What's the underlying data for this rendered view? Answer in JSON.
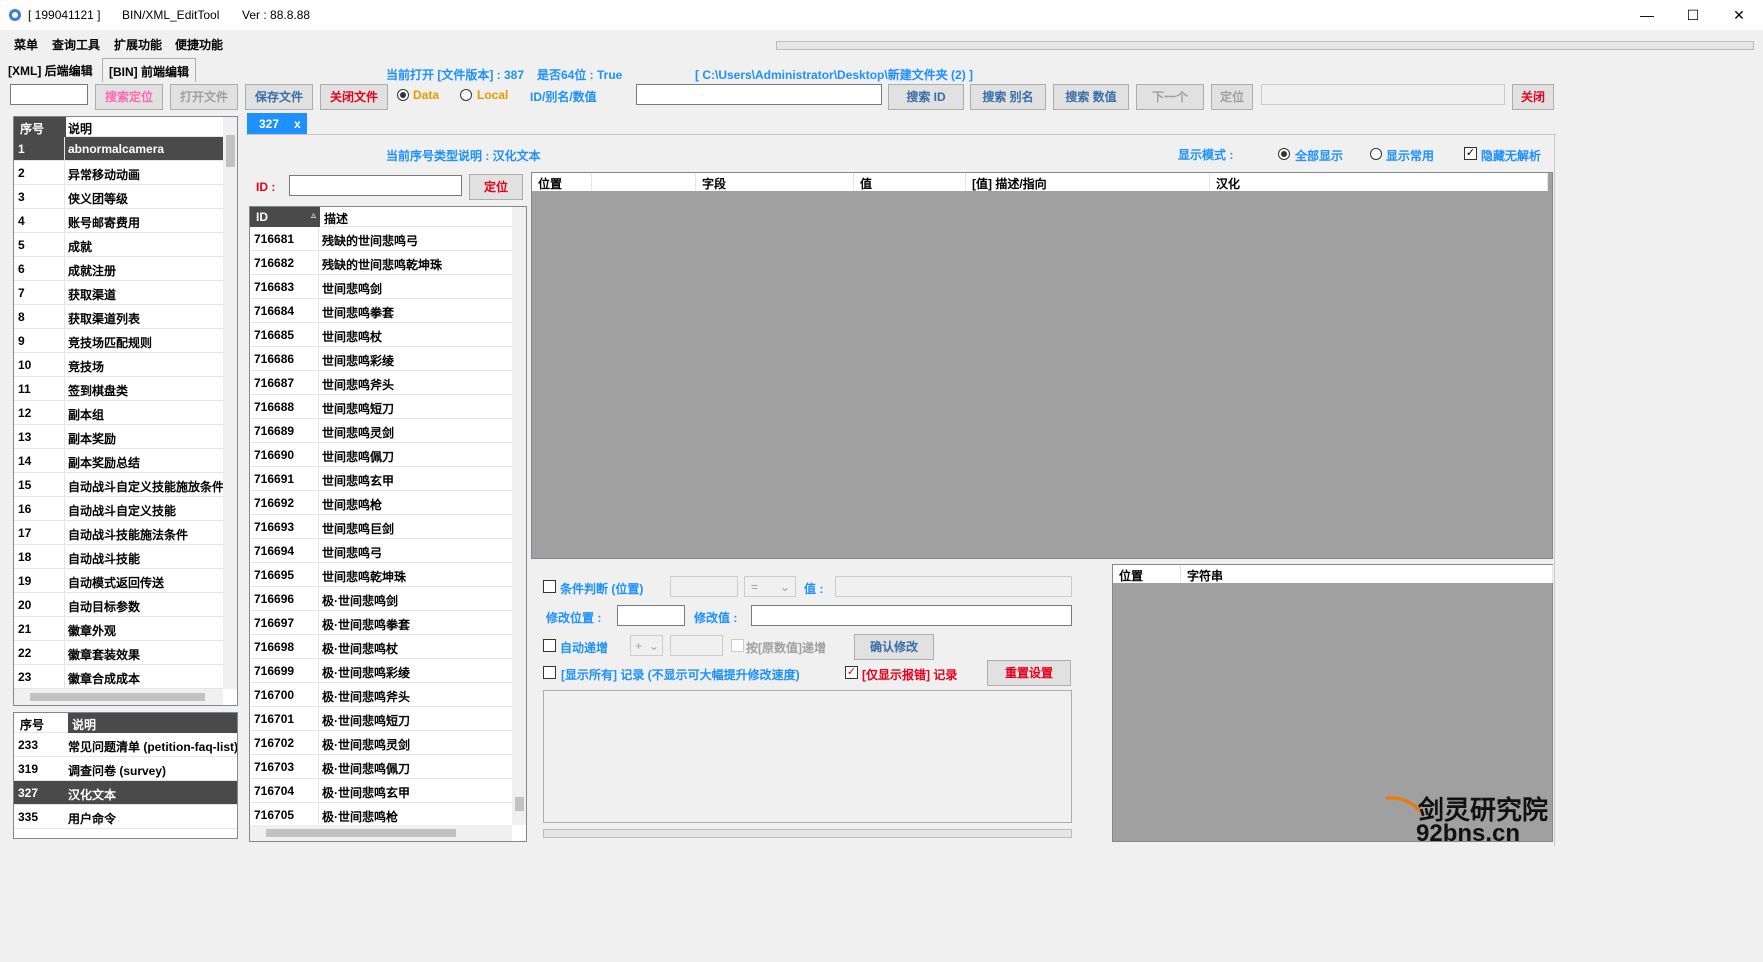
{
  "window": {
    "title_id": "[ 199041121 ]",
    "app_name": "BIN/XML_EditTool",
    "version": "Ver : 88.8.88",
    "minimize": "—",
    "maximize": "☐",
    "close": "✕"
  },
  "menu": [
    "菜单",
    "查询工具",
    "扩展功能",
    "便捷功能"
  ],
  "tabs": [
    "[XML] 后端编辑",
    "[BIN] 前端编辑"
  ],
  "info": {
    "current_open": "当前打开 [文件版本] : 387",
    "is64": "是否64位 : True",
    "path": "[ C:\\Users\\Administrator\\Desktop\\新建文件夹 (2) ]"
  },
  "toolbar": {
    "search_locate": "搜索定位",
    "open_file": "打开文件",
    "save_file": "保存文件",
    "close_file": "关闭文件",
    "radio_data": "Data",
    "radio_local": "Local",
    "search_label": "ID/别名/数值",
    "search_id": "搜索 ID",
    "search_alias": "搜索 别名",
    "search_value": "搜索 数值",
    "next": "下一个",
    "locate": "定位",
    "close": "关闭"
  },
  "left_list": {
    "headers": [
      "序号",
      "说明"
    ],
    "rows": [
      [
        "1",
        "abnormalcamera"
      ],
      [
        "2",
        "异常移动动画"
      ],
      [
        "3",
        "侠义团等级"
      ],
      [
        "4",
        "账号邮寄费用"
      ],
      [
        "5",
        "成就"
      ],
      [
        "6",
        "成就注册"
      ],
      [
        "7",
        "获取渠道"
      ],
      [
        "8",
        "获取渠道列表"
      ],
      [
        "9",
        "竞技场匹配规则"
      ],
      [
        "10",
        "竞技场"
      ],
      [
        "11",
        "签到棋盘类"
      ],
      [
        "12",
        "副本组"
      ],
      [
        "13",
        "副本奖励"
      ],
      [
        "14",
        "副本奖励总结"
      ],
      [
        "15",
        "自动战斗自定义技能施放条件"
      ],
      [
        "16",
        "自动战斗自定义技能"
      ],
      [
        "17",
        "自动战斗技能施法条件"
      ],
      [
        "18",
        "自动战斗技能"
      ],
      [
        "19",
        "自动模式返回传送"
      ],
      [
        "20",
        "自动目标参数"
      ],
      [
        "21",
        "徽章外观"
      ],
      [
        "22",
        "徽章套装效果"
      ],
      [
        "23",
        "徽章合成成本"
      ]
    ]
  },
  "left_bottom_list": {
    "headers": [
      "序号",
      "说明"
    ],
    "rows": [
      [
        "233",
        "常见问题清单 (petition-faq-list)"
      ],
      [
        "319",
        "调查问卷 (survey)"
      ],
      [
        "327",
        "汉化文本"
      ],
      [
        "335",
        "用户命令"
      ]
    ]
  },
  "doc_tab": {
    "label": "327",
    "close": "x"
  },
  "type_desc": "当前序号类型说明 : 汉化文本",
  "display_mode": {
    "label": "显示模式 :",
    "all": "全部显示",
    "common": "显示常用",
    "hide": "隐藏无解析"
  },
  "id_locate": {
    "label": "ID :",
    "button": "定位"
  },
  "id_list": {
    "headers": [
      "ID",
      "描述"
    ],
    "sort_glyph": "▵",
    "rows": [
      [
        "716681",
        "残缺的世间悲鸣弓"
      ],
      [
        "716682",
        "残缺的世间悲鸣乾坤珠"
      ],
      [
        "716683",
        "世间悲鸣剑"
      ],
      [
        "716684",
        "世间悲鸣拳套"
      ],
      [
        "716685",
        "世间悲鸣杖"
      ],
      [
        "716686",
        "世间悲鸣彩绫"
      ],
      [
        "716687",
        "世间悲鸣斧头"
      ],
      [
        "716688",
        "世间悲鸣短刀"
      ],
      [
        "716689",
        "世间悲鸣灵剑"
      ],
      [
        "716690",
        "世间悲鸣佩刀"
      ],
      [
        "716691",
        "世间悲鸣玄甲"
      ],
      [
        "716692",
        "世间悲鸣枪"
      ],
      [
        "716693",
        "世间悲鸣巨剑"
      ],
      [
        "716694",
        "世间悲鸣弓"
      ],
      [
        "716695",
        "世间悲鸣乾坤珠"
      ],
      [
        "716696",
        "极·世间悲鸣剑"
      ],
      [
        "716697",
        "极·世间悲鸣拳套"
      ],
      [
        "716698",
        "极·世间悲鸣杖"
      ],
      [
        "716699",
        "极·世间悲鸣彩绫"
      ],
      [
        "716700",
        "极·世间悲鸣斧头"
      ],
      [
        "716701",
        "极·世间悲鸣短刀"
      ],
      [
        "716702",
        "极·世间悲鸣灵剑"
      ],
      [
        "716703",
        "极·世间悲鸣佩刀"
      ],
      [
        "716704",
        "极·世间悲鸣玄甲"
      ],
      [
        "716705",
        "极·世间悲鸣枪"
      ]
    ]
  },
  "detail_grid": {
    "headers": [
      "位置",
      "字段",
      "值",
      "[值] 描述/指向",
      "汉化"
    ]
  },
  "edit_panel": {
    "cond_label": "条件判断 (位置)",
    "op": "=",
    "value_label": "值 :",
    "modify_pos": "修改位置 :",
    "modify_value": "修改值 :",
    "auto_inc": "自动递增",
    "inc_op": "+",
    "by_orig": "按[原数值]递增",
    "confirm": "确认修改",
    "show_all_log": "[显示所有] 记录 (不显示可大幅提升修改速度)",
    "show_err_log": "[仅显示报错] 记录",
    "reset": "重置设置"
  },
  "string_grid": {
    "headers": [
      "位置",
      "字符串"
    ]
  },
  "watermark": {
    "line1": "剑灵研究院",
    "line2": "92bns.cn"
  }
}
